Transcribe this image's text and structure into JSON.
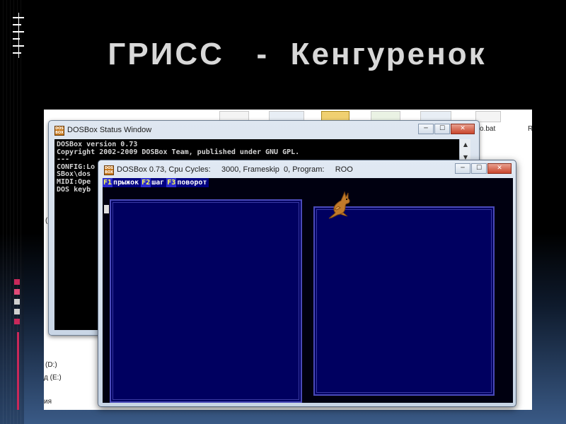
{
  "slide": {
    "title": "ГРИСС   -  Кенгуренок"
  },
  "explorer": {
    "files": [
      "o.bat",
      "R"
    ],
    "drives": [
      "(D:)",
      "д (E:)",
      "ия"
    ],
    "side_char": "("
  },
  "status_window": {
    "title": "DOSBox Status Window",
    "icon_text": "DOS BOX",
    "console_lines": [
      "DOSBox version 0.73",
      "Copyright 2002-2009 DOSBox Team, published under GNU GPL.",
      "---",
      "CONFIG:Lo",
      "SBox\\dos",
      "MIDI:Ope",
      "DOS keyb"
    ],
    "scroll_up": "▲",
    "scroll_down": "▼"
  },
  "dos_window": {
    "title": "DOSBox 0.73, Cpu Cycles:     3000, Frameskip  0, Program:     ROO",
    "icon_text": "DOS BOX",
    "menu": [
      {
        "key": "F1",
        "label": "прыжок"
      },
      {
        "key": "F2",
        "label": "шаг"
      },
      {
        "key": "F3",
        "label": "поворот"
      }
    ],
    "sprite_icon": "kangaroo-icon"
  },
  "window_buttons": {
    "minimize": "─",
    "maximize": "☐",
    "close": "✕"
  },
  "colors": {
    "dos_screen": "#000010",
    "panel_fill": "#000060",
    "panel_border": "#4a4ab8",
    "menu_key_bg": "#2c2ccf",
    "menu_key_fg": "#ffff55",
    "kangaroo": "#c07a2a",
    "accent_stripe": "#c8285a"
  }
}
